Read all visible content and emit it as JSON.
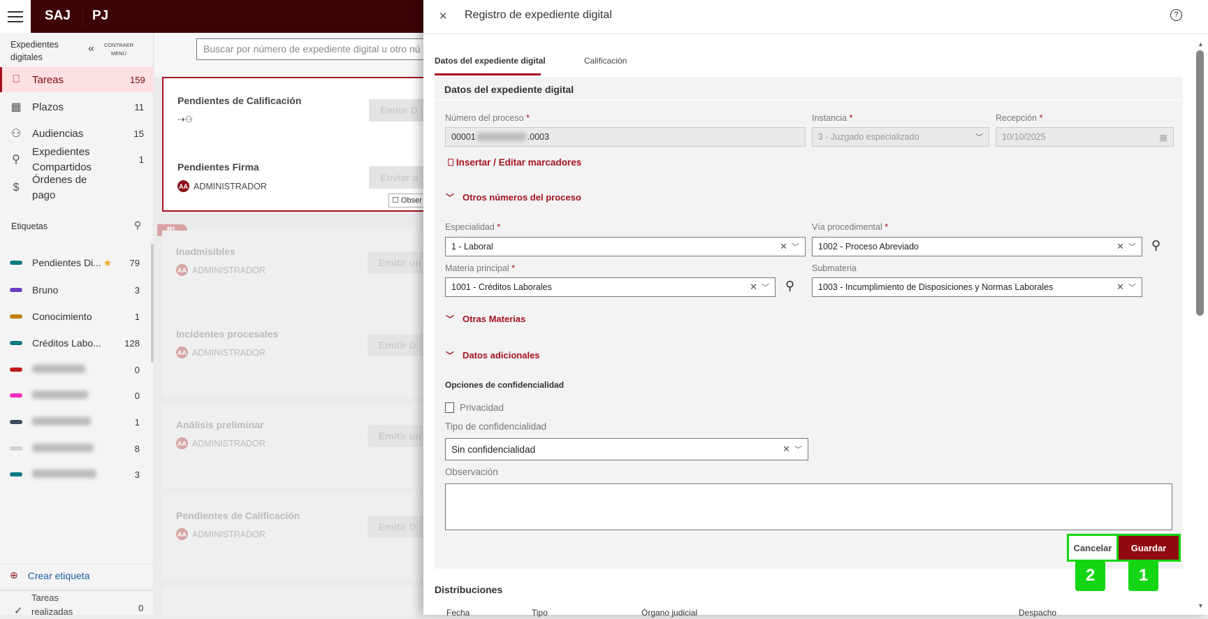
{
  "topbar": {
    "brand1": "SAJ",
    "brand2": "PJ"
  },
  "sidebar": {
    "title": "Expedientes digitales",
    "collapse_label": "CONTRAER MENÚ",
    "items": [
      {
        "label": "Tareas",
        "count": "159"
      },
      {
        "label": "Plazos",
        "count": "11"
      },
      {
        "label": "Audiencias",
        "count": "15"
      },
      {
        "label": "Expedientes Compartidos",
        "count": "1"
      },
      {
        "label": "Órdenes de pago",
        "count": ""
      }
    ],
    "tags_title": "Etiquetas",
    "tags": [
      {
        "label": "Pendientes Di...",
        "count": "79",
        "color": "#0b7a83"
      },
      {
        "label": "Bruno",
        "count": "3",
        "color": "#6b3fbf"
      },
      {
        "label": "Conocimiento",
        "count": "1",
        "color": "#c07f0a"
      },
      {
        "label": "Créditos Labo...",
        "count": "128",
        "color": "#0b7a83"
      },
      {
        "label": "",
        "count": "0",
        "color": "#c0171d"
      },
      {
        "label": "",
        "count": "0",
        "color": "#f02ebd"
      },
      {
        "label": "",
        "count": "1",
        "color": "#3b4a5e"
      },
      {
        "label": "",
        "count": "8",
        "color": "#d2d2d2"
      },
      {
        "label": "",
        "count": "3",
        "color": "#0b7a83"
      }
    ],
    "create_tag": "Crear etiqueta",
    "done_label": "Tareas realizadas",
    "done_count": "0"
  },
  "main": {
    "search_placeholder": "Buscar por número de expediente digital u otro nú",
    "cards": [
      {
        "title": "Pendientes de Calificación",
        "user": "",
        "button": "Emitir D"
      },
      {
        "title": "Pendientes Firma",
        "user": "ADMINISTRADOR",
        "button": "Enviar a",
        "extra": "Obser"
      },
      {
        "title": "Inadmisibles",
        "user": "ADMINISTRADOR",
        "button": "Emitir un",
        "badge": "RL"
      },
      {
        "title": "Incidentes procesales",
        "user": "ADMINISTRADOR",
        "button": "Emitir D"
      },
      {
        "title": "Análisis preliminar",
        "user": "ADMINISTRADOR",
        "button": "Emitir un"
      },
      {
        "title": "Pendientes de Calificación",
        "user": "ADMINISTRADOR",
        "button": "Emitir D"
      }
    ],
    "avatar_initials": "AA"
  },
  "panel": {
    "title": "Registro de expediente digital",
    "tabs": [
      "Datos del expediente digital",
      "Calificación"
    ],
    "section_title": "Datos del expediente digital",
    "numero_label": "Número del proceso",
    "numero_prefix": "00001",
    "numero_suffix": ".0003",
    "instancia_label": "Instancia",
    "instancia_value": "3 - Juzgado especializado",
    "recepcion_label": "Recepción",
    "recepcion_value": "10/10/2025",
    "marcadores": "Insertar / Editar marcadores",
    "otros_numeros": "Otros números del proceso",
    "especialidad_label": "Especialidad",
    "especialidad_value": "1 - Laboral",
    "via_label": "Vía procedimental",
    "via_value": "1002 - Proceso Abreviado",
    "materia_label": "Materia principal",
    "materia_value": "1001 - Créditos Laborales",
    "submateria_label": "Submateria",
    "submateria_value": "1003 - Incumplimiento de Disposiciones y Normas Laborales",
    "otras_materias": "Otras Materias",
    "datos_adicionales": "Datos adicionales",
    "confid_title": "Opciones de confidencialidad",
    "privacidad": "Privacidad",
    "tipo_label": "Tipo de confidencialidad",
    "tipo_value": "Sin confidencialidad",
    "observacion_label": "Observación",
    "cancel": "Cancelar",
    "save": "Guardar",
    "badge_save": "1",
    "badge_cancel": "2",
    "distribuciones": "Distribuciones",
    "dist_headers": [
      "Fecha",
      "Tipo",
      "Órgano judicial",
      "Despacho"
    ]
  }
}
